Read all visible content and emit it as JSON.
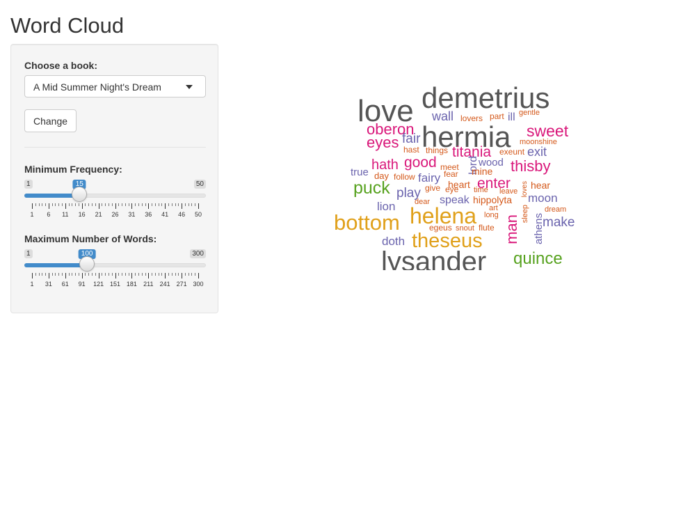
{
  "page": {
    "title": "Word Cloud"
  },
  "sidebar": {
    "book_label": "Choose a book:",
    "book_selected": "A Mid Summer Night's Dream",
    "change_label": "Change",
    "min_freq": {
      "label": "Minimum Frequency:",
      "min": 1,
      "max": 50,
      "value": 15,
      "min_text": "1",
      "max_text": "50",
      "value_text": "15",
      "ticks": [
        "1",
        "6",
        "11",
        "16",
        "21",
        "26",
        "31",
        "36",
        "41",
        "46",
        "50"
      ]
    },
    "max_words": {
      "label": "Maximum Number of Words:",
      "min": 1,
      "max": 300,
      "value": 100,
      "min_text": "1",
      "max_text": "300",
      "value_text": "100",
      "ticks": [
        "1",
        "31",
        "61",
        "91",
        "121",
        "151",
        "181",
        "211",
        "241",
        "271",
        "300"
      ]
    }
  },
  "colors": {
    "accent": "#428bca",
    "gray": "#555555",
    "pink": "#d9177a",
    "orange": "#d4581a",
    "purple": "#6a63ad",
    "gold": "#e0a01a",
    "green": "#57a21f"
  },
  "cloud": {
    "words": [
      {
        "text": "demetrius",
        "c": "gray"
      },
      {
        "text": "love",
        "c": "gray"
      },
      {
        "text": "hermia",
        "c": "gray"
      },
      {
        "text": "lysander",
        "c": "gray"
      },
      {
        "text": "helena",
        "c": "gold"
      },
      {
        "text": "bottom",
        "c": "gold"
      },
      {
        "text": "theseus",
        "c": "gold"
      },
      {
        "text": "wall",
        "c": "purple"
      },
      {
        "text": "lovers",
        "c": "orange"
      },
      {
        "text": "part",
        "c": "orange"
      },
      {
        "text": "ill",
        "c": "purple"
      },
      {
        "text": "gentle",
        "c": "orange"
      },
      {
        "text": "oberon",
        "c": "pink"
      },
      {
        "text": "eyes",
        "c": "pink"
      },
      {
        "text": "fair",
        "c": "purple"
      },
      {
        "text": "sweet",
        "c": "pink"
      },
      {
        "text": "moonshine",
        "c": "orange"
      },
      {
        "text": "hast",
        "c": "orange"
      },
      {
        "text": "things",
        "c": "orange"
      },
      {
        "text": "titania",
        "c": "pink"
      },
      {
        "text": "exeunt",
        "c": "orange"
      },
      {
        "text": "exit",
        "c": "purple"
      },
      {
        "text": "hath",
        "c": "pink"
      },
      {
        "text": "good",
        "c": "pink"
      },
      {
        "text": "meet",
        "c": "orange"
      },
      {
        "text": "lord",
        "c": "purple"
      },
      {
        "text": "wood",
        "c": "purple"
      },
      {
        "text": "thisby",
        "c": "pink"
      },
      {
        "text": "true",
        "c": "purple"
      },
      {
        "text": "day",
        "c": "orange"
      },
      {
        "text": "follow",
        "c": "orange"
      },
      {
        "text": "fairy",
        "c": "purple"
      },
      {
        "text": "fear",
        "c": "orange"
      },
      {
        "text": "mine",
        "c": "orange"
      },
      {
        "text": "puck",
        "c": "green"
      },
      {
        "text": "heart",
        "c": "orange"
      },
      {
        "text": "enter",
        "c": "pink"
      },
      {
        "text": "hear",
        "c": "orange"
      },
      {
        "text": "play",
        "c": "purple"
      },
      {
        "text": "give",
        "c": "orange"
      },
      {
        "text": "eye",
        "c": "orange"
      },
      {
        "text": "time",
        "c": "orange"
      },
      {
        "text": "leave",
        "c": "orange"
      },
      {
        "text": "loves",
        "c": "orange"
      },
      {
        "text": "lion",
        "c": "purple"
      },
      {
        "text": "dear",
        "c": "orange"
      },
      {
        "text": "speak",
        "c": "purple"
      },
      {
        "text": "hippolyta",
        "c": "orange"
      },
      {
        "text": "moon",
        "c": "purple"
      },
      {
        "text": "art",
        "c": "orange"
      },
      {
        "text": "long",
        "c": "orange"
      },
      {
        "text": "sleep",
        "c": "orange"
      },
      {
        "text": "dream",
        "c": "orange"
      },
      {
        "text": "make",
        "c": "purple"
      },
      {
        "text": "egeus",
        "c": "orange"
      },
      {
        "text": "snout",
        "c": "orange"
      },
      {
        "text": "flute",
        "c": "orange"
      },
      {
        "text": "man",
        "c": "pink"
      },
      {
        "text": "athens",
        "c": "purple"
      },
      {
        "text": "doth",
        "c": "purple"
      },
      {
        "text": "quince",
        "c": "green"
      }
    ]
  }
}
